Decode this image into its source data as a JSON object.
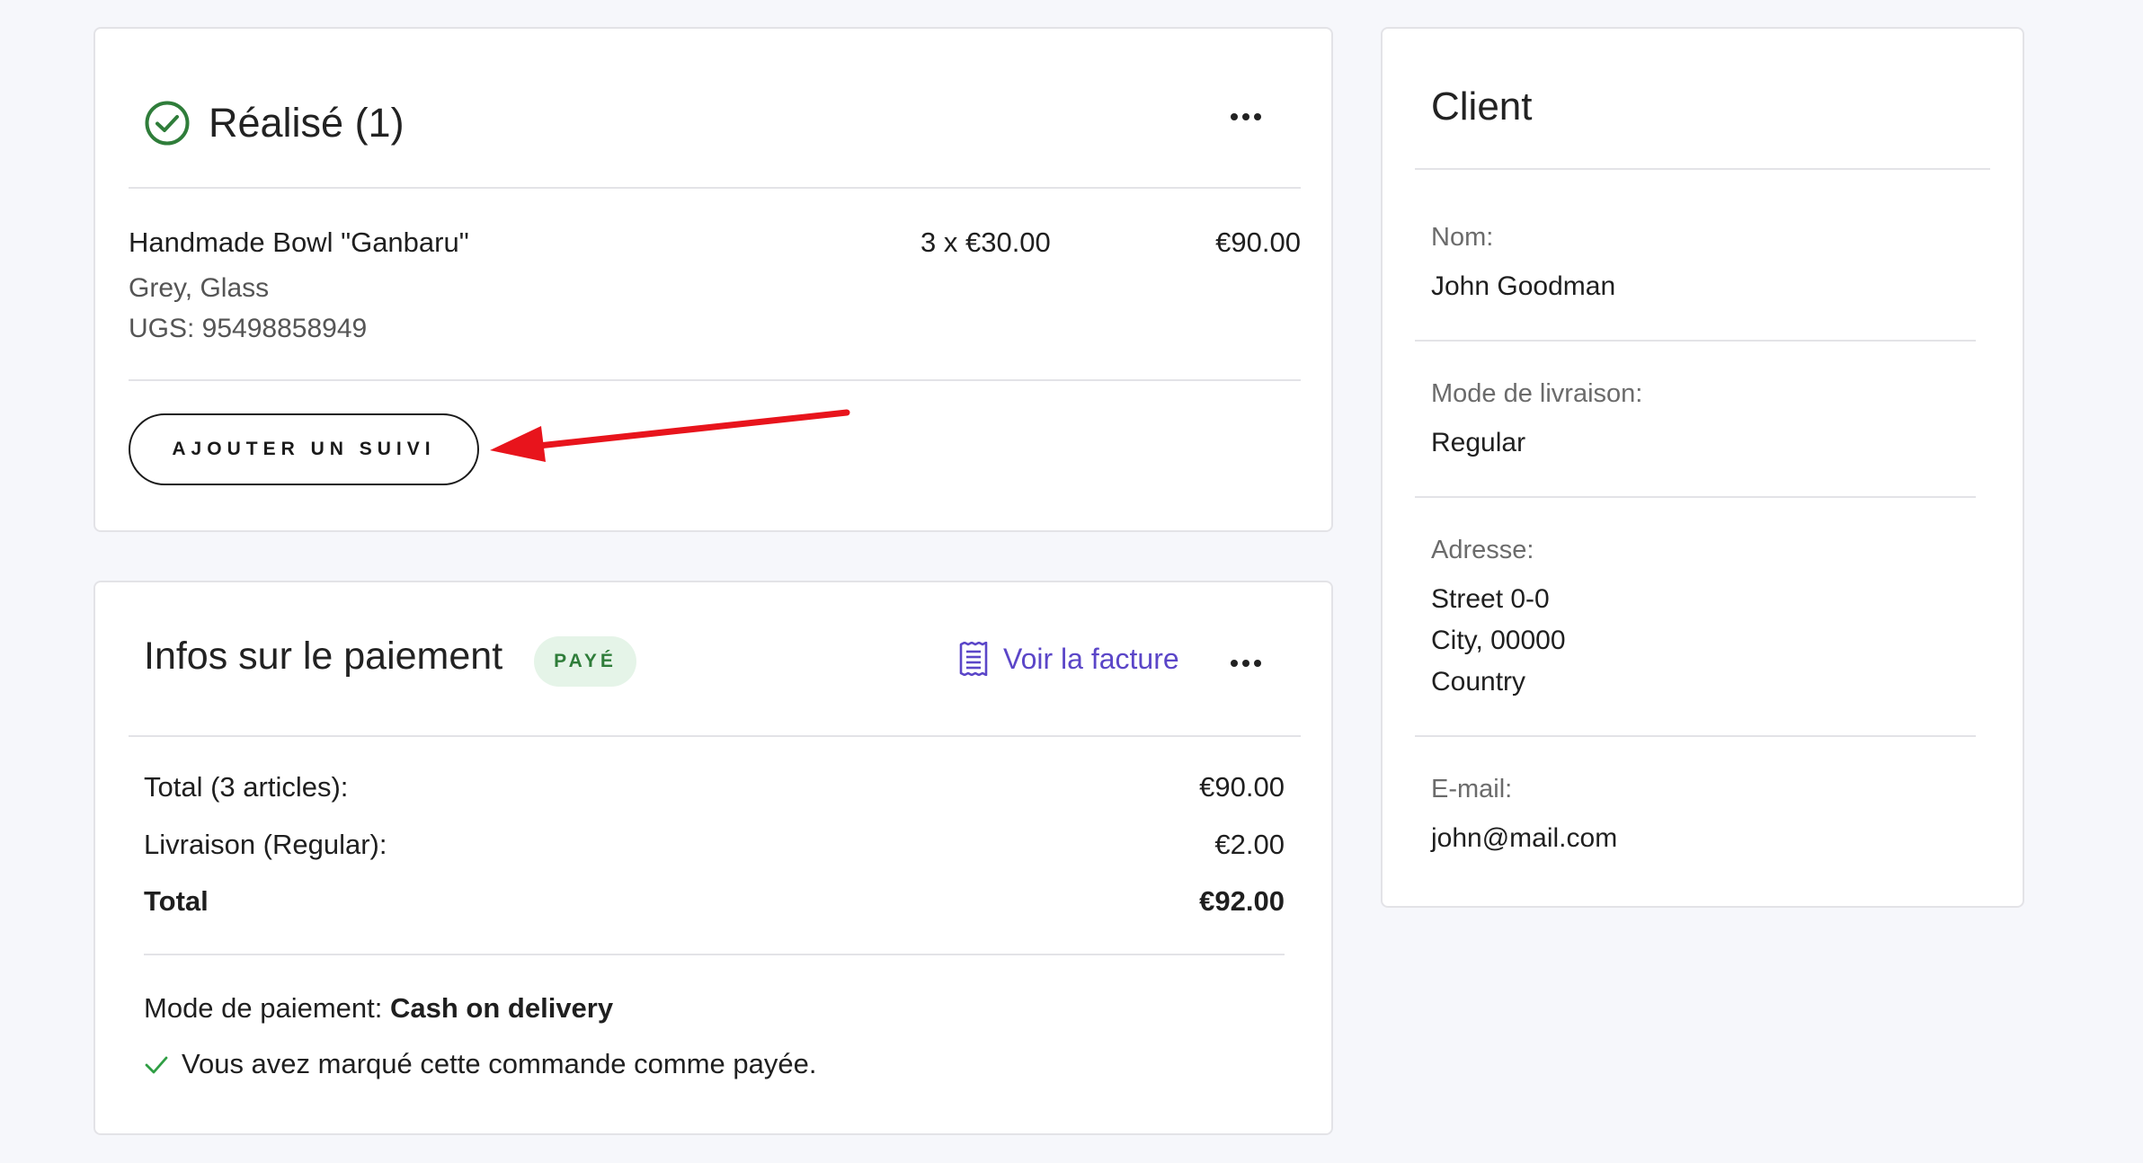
{
  "fulfilled": {
    "title": "Réalisé (1)",
    "item": {
      "name": "Handmade Bowl \"Ganbaru\"",
      "variant": "Grey, Glass",
      "sku": "UGS: 95498858949",
      "quantity_price": "3 x €30.00",
      "total": "€90.00"
    },
    "add_tracking_label": "AJOUTER UN SUIVI"
  },
  "payment": {
    "title": "Infos sur le paiement",
    "status_badge": "PAYÉ",
    "invoice_link": "Voir la facture",
    "rows": [
      {
        "label": "Total (3 articles):",
        "value": "€90.00"
      },
      {
        "label": "Livraison (Regular):",
        "value": "€2.00"
      },
      {
        "label": "Total",
        "value": "€92.00"
      }
    ],
    "method_label": "Mode de paiement: ",
    "method_value": "Cash on delivery",
    "paid_note": "Vous avez marqué cette commande comme payée."
  },
  "client": {
    "title": "Client",
    "name_label": "Nom:",
    "name_value": "John Goodman",
    "shipping_label": "Mode de livraison:",
    "shipping_value": "Regular",
    "address_label": "Adresse:",
    "address_lines": [
      "Street 0-0",
      "City, 00000",
      "Country"
    ],
    "email_label": "E-mail:",
    "email_value": "john@mail.com"
  },
  "colors": {
    "success_green": "#2f7d3a",
    "badge_bg": "#e5f4e8",
    "link_purple": "#5b46c8",
    "annotation_red": "#e8141c"
  },
  "icons": {
    "status": "check-circle-icon",
    "more": "more-horizontal-icon",
    "invoice": "receipt-icon",
    "paid_check": "check-icon",
    "annotation": "red-arrow"
  }
}
